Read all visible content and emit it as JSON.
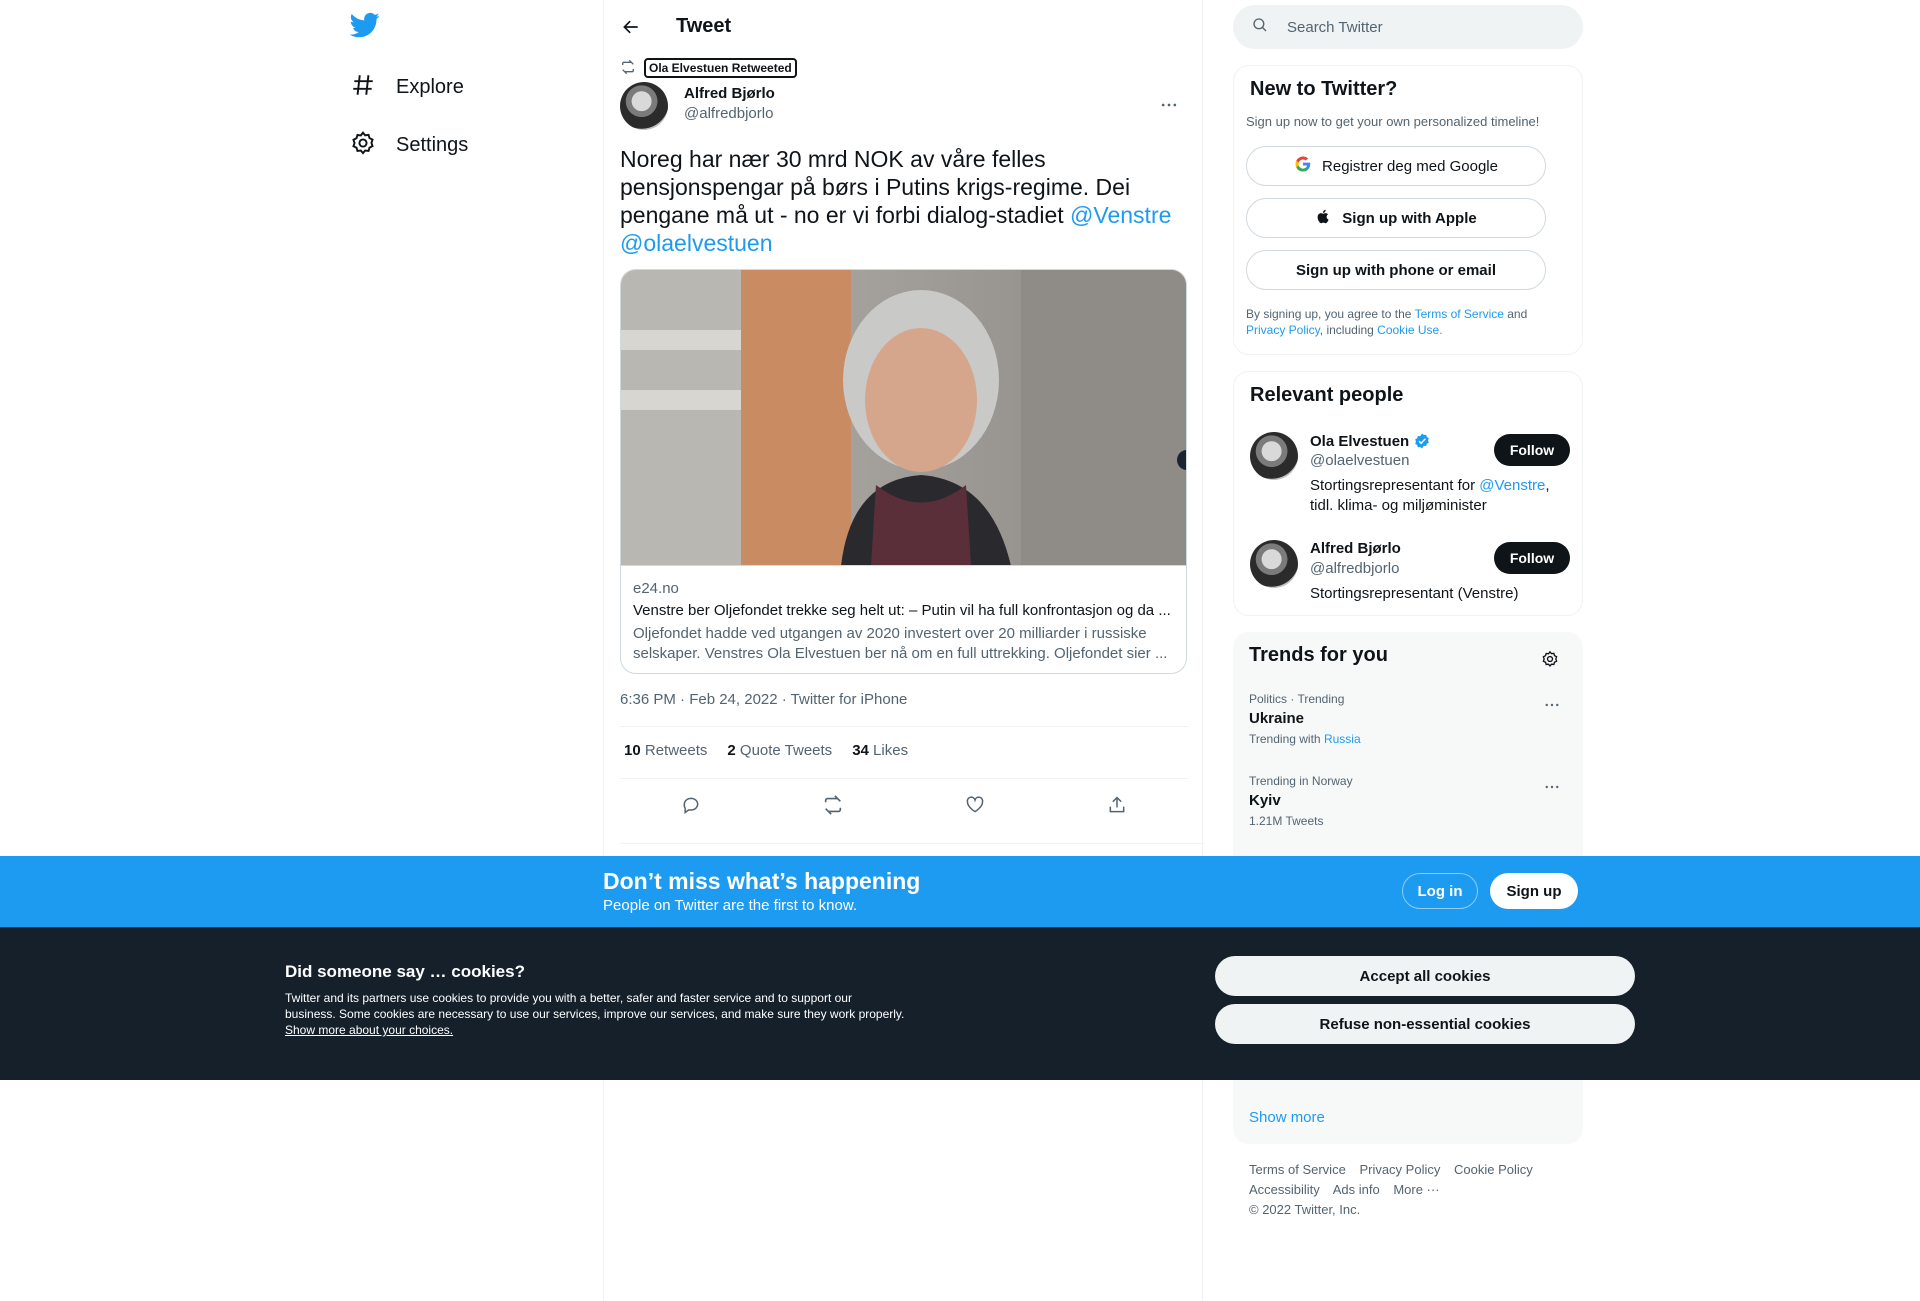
{
  "colors": {
    "brand": "#1d9bf0",
    "text": "#0f1419",
    "secondary": "#536471",
    "cookie_bg": "#15202b"
  },
  "nav": {
    "logo_icon": "twitter-bird-icon",
    "items": [
      {
        "label": "Explore",
        "icon": "hashtag-icon"
      },
      {
        "label": "Settings",
        "icon": "gear-icon"
      }
    ]
  },
  "header": {
    "title": "Tweet"
  },
  "tweet": {
    "retweeted_by": "Ola Elvestuen Retweeted",
    "author_name": "Alfred Bjørlo",
    "author_handle": "@alfredbjorlo",
    "text": "Noreg har nær 30 mrd NOK av våre felles pensjonspengar på børs i Putins krigs-regime. Dei pengane må ut - no er vi forbi dialog-stadiet ",
    "mention1": "@Venstre",
    "mention2": "@olaelvestuen",
    "card": {
      "domain": "e24.no",
      "title": "Venstre ber Oljefondet trekke seg helt ut: – Putin vil ha full konfrontasjon og da ...",
      "description": "Oljefondet hadde ved utgangen av 2020 investert over 20 milliarder i russiske selskaper. Venstres Ola Elvestuen ber nå om en full uttrekking. Oljefondet sier ..."
    },
    "timestamp": "6:36 PM · Feb 24, 2022 · Twitter for iPhone",
    "stats": {
      "retweets_count": "10",
      "retweets_label": "Retweets",
      "quotes_count": "2",
      "quotes_label": "Quote Tweets",
      "likes_count": "34",
      "likes_label": "Likes"
    }
  },
  "search": {
    "placeholder": "Search Twitter"
  },
  "new_to_twitter": {
    "title": "New to Twitter?",
    "subtitle": "Sign up now to get your own personalized timeline!",
    "google_btn": "Registrer deg med Google",
    "apple_btn": "Sign up with Apple",
    "phone_btn": "Sign up with phone or email",
    "terms_prefix": "By signing up, you agree to the ",
    "terms_link": "Terms of Service",
    "terms_and": " and ",
    "privacy_link": "Privacy Policy",
    "terms_including": ", including ",
    "cookie_link": "Cookie Use."
  },
  "relevant_people": {
    "title": "Relevant people",
    "people": [
      {
        "name": "Ola Elvestuen",
        "handle": "@olaelvestuen",
        "bio_prefix": "Stortingsrepresentant for ",
        "bio_link": "@Venstre",
        "bio_suffix": ", tidl. klima- og miljøminister",
        "follow": "Follow"
      },
      {
        "name": "Alfred Bjørlo",
        "handle": "@alfredbjorlo",
        "bio_prefix": "Stortingsrepresentant (Venstre)",
        "follow": "Follow"
      }
    ]
  },
  "trends": {
    "title": "Trends for you",
    "items": [
      {
        "context": "Politics · Trending",
        "name": "Ukraine",
        "meta_prefix": "Trending with ",
        "meta_link": "Russia"
      },
      {
        "context": "Trending in Norway",
        "name": "Kyiv",
        "meta_prefix": "1.21M Tweets"
      }
    ],
    "show_more": "Show more"
  },
  "footer": {
    "links": [
      "Terms of Service",
      "Privacy Policy",
      "Cookie Policy",
      "Accessibility",
      "Ads info",
      "More ···"
    ],
    "copyright": "© 2022 Twitter, Inc."
  },
  "banner": {
    "heading": "Don’t miss what’s happening",
    "subheading": "People on Twitter are the first to know.",
    "login": "Log in",
    "signup": "Sign up"
  },
  "cookies": {
    "heading": "Did someone say … cookies?",
    "body": "Twitter and its partners use cookies to provide you with a better, safer and faster service and to support our business. Some cookies are necessary to use our services, improve our services, and make sure they work properly. ",
    "link": "Show more about your choices.",
    "accept": "Accept all cookies",
    "refuse": "Refuse non-essential cookies"
  }
}
